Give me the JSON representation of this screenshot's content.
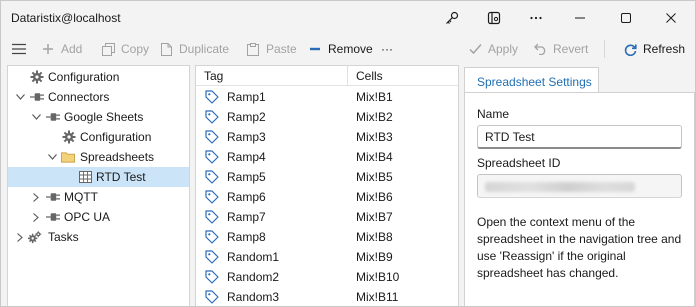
{
  "window": {
    "title": "Dataristix@localhost",
    "buttons": [
      "key-icon",
      "window-settings-icon",
      "more-icon",
      "minimize-icon",
      "maximize-icon",
      "close-icon"
    ]
  },
  "toolbar": {
    "add": "Add",
    "copy": "Copy",
    "duplicate": "Duplicate",
    "paste": "Paste",
    "remove": "Remove",
    "more": "···",
    "apply": "Apply",
    "revert": "Revert",
    "refresh": "Refresh",
    "accent": "#2a6cb5"
  },
  "tree": {
    "items": [
      {
        "label": "Configuration",
        "icon": "gear-icon"
      },
      {
        "label": "Connectors",
        "icon": "plug-icon"
      },
      {
        "label": "Google Sheets",
        "icon": "plug-icon"
      },
      {
        "label": "Configuration",
        "icon": "gear-icon"
      },
      {
        "label": "Spreadsheets",
        "icon": "folder-icon"
      },
      {
        "label": "RTD Test",
        "icon": "sheet-icon"
      },
      {
        "label": "MQTT",
        "icon": "plug-icon"
      },
      {
        "label": "OPC UA",
        "icon": "plug-icon"
      },
      {
        "label": "Tasks",
        "icon": "gears-icon"
      }
    ]
  },
  "grid": {
    "columns": [
      "Tag",
      "Cells"
    ],
    "rows": [
      {
        "tag": "Ramp1",
        "cells": "Mix!B1"
      },
      {
        "tag": "Ramp2",
        "cells": "Mix!B2"
      },
      {
        "tag": "Ramp3",
        "cells": "Mix!B3"
      },
      {
        "tag": "Ramp4",
        "cells": "Mix!B4"
      },
      {
        "tag": "Ramp5",
        "cells": "Mix!B5"
      },
      {
        "tag": "Ramp6",
        "cells": "Mix!B6"
      },
      {
        "tag": "Ramp7",
        "cells": "Mix!B7"
      },
      {
        "tag": "Ramp8",
        "cells": "Mix!B8"
      },
      {
        "tag": "Random1",
        "cells": "Mix!B9"
      },
      {
        "tag": "Random2",
        "cells": "Mix!B10"
      },
      {
        "tag": "Random3",
        "cells": "Mix!B11"
      }
    ]
  },
  "settings": {
    "tab": "Spreadsheet Settings",
    "name_label": "Name",
    "name_value": "RTD Test",
    "id_label": "Spreadsheet ID",
    "help": "Open the context menu of the spreadsheet in the navigation tree and use 'Reassign' if the original spreadsheet has changed."
  }
}
